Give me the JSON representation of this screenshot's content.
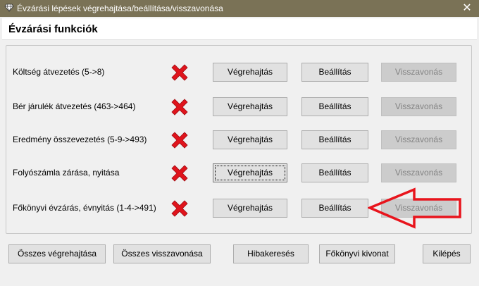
{
  "window": {
    "title": "Évzárási lépések végrehajtása/beállítása/visszavonása",
    "close_glyph": "✕",
    "icon": "diamond-icon"
  },
  "header": {
    "heading": "Évzárási funkciók"
  },
  "rows": [
    {
      "label": "Költség átvezetés (5->8)",
      "status": "not-done-red-x",
      "execute_label": "Végrehajtás",
      "settings_label": "Beállítás",
      "undo_label": "Visszavonás",
      "undo_enabled": false
    },
    {
      "label": "Bér járulék átvezetés (463->464)",
      "status": "not-done-red-x",
      "execute_label": "Végrehajtás",
      "settings_label": "Beállítás",
      "undo_label": "Visszavonás",
      "undo_enabled": false
    },
    {
      "label": "Eredmény összevezetés (5-9->493)",
      "status": "not-done-red-x",
      "execute_label": "Végrehajtás",
      "settings_label": "Beállítás",
      "undo_label": "Visszavonás",
      "undo_enabled": false
    },
    {
      "label": "Folyószámla zárása, nyitása",
      "status": "not-done-red-x",
      "execute_label": "Végrehajtás",
      "settings_label": "Beállítás",
      "undo_label": "Visszavonás",
      "undo_enabled": false
    },
    {
      "label": "Főkönyvi évzárás, évnyitás (1-4->491)",
      "status": "not-done-red-x",
      "execute_label": "Végrehajtás",
      "settings_label": "Beállítás",
      "undo_label": "Visszavonás",
      "undo_enabled": false
    }
  ],
  "bottom": {
    "execute_all_label": "Összes végrehajtása",
    "undo_all_label": "Összes visszavonása",
    "debug_label": "Hibakeresés",
    "ledger_label": "Főkönyvi kivonat",
    "exit_label": "Kilépés"
  },
  "annotation": {
    "arrow_color": "#e8141c",
    "points_to": "row 5 Visszavonás button"
  },
  "colors": {
    "titlebar": "#7a7256",
    "x_mark": "#e0141c",
    "disabled_button": "#cccccc"
  }
}
